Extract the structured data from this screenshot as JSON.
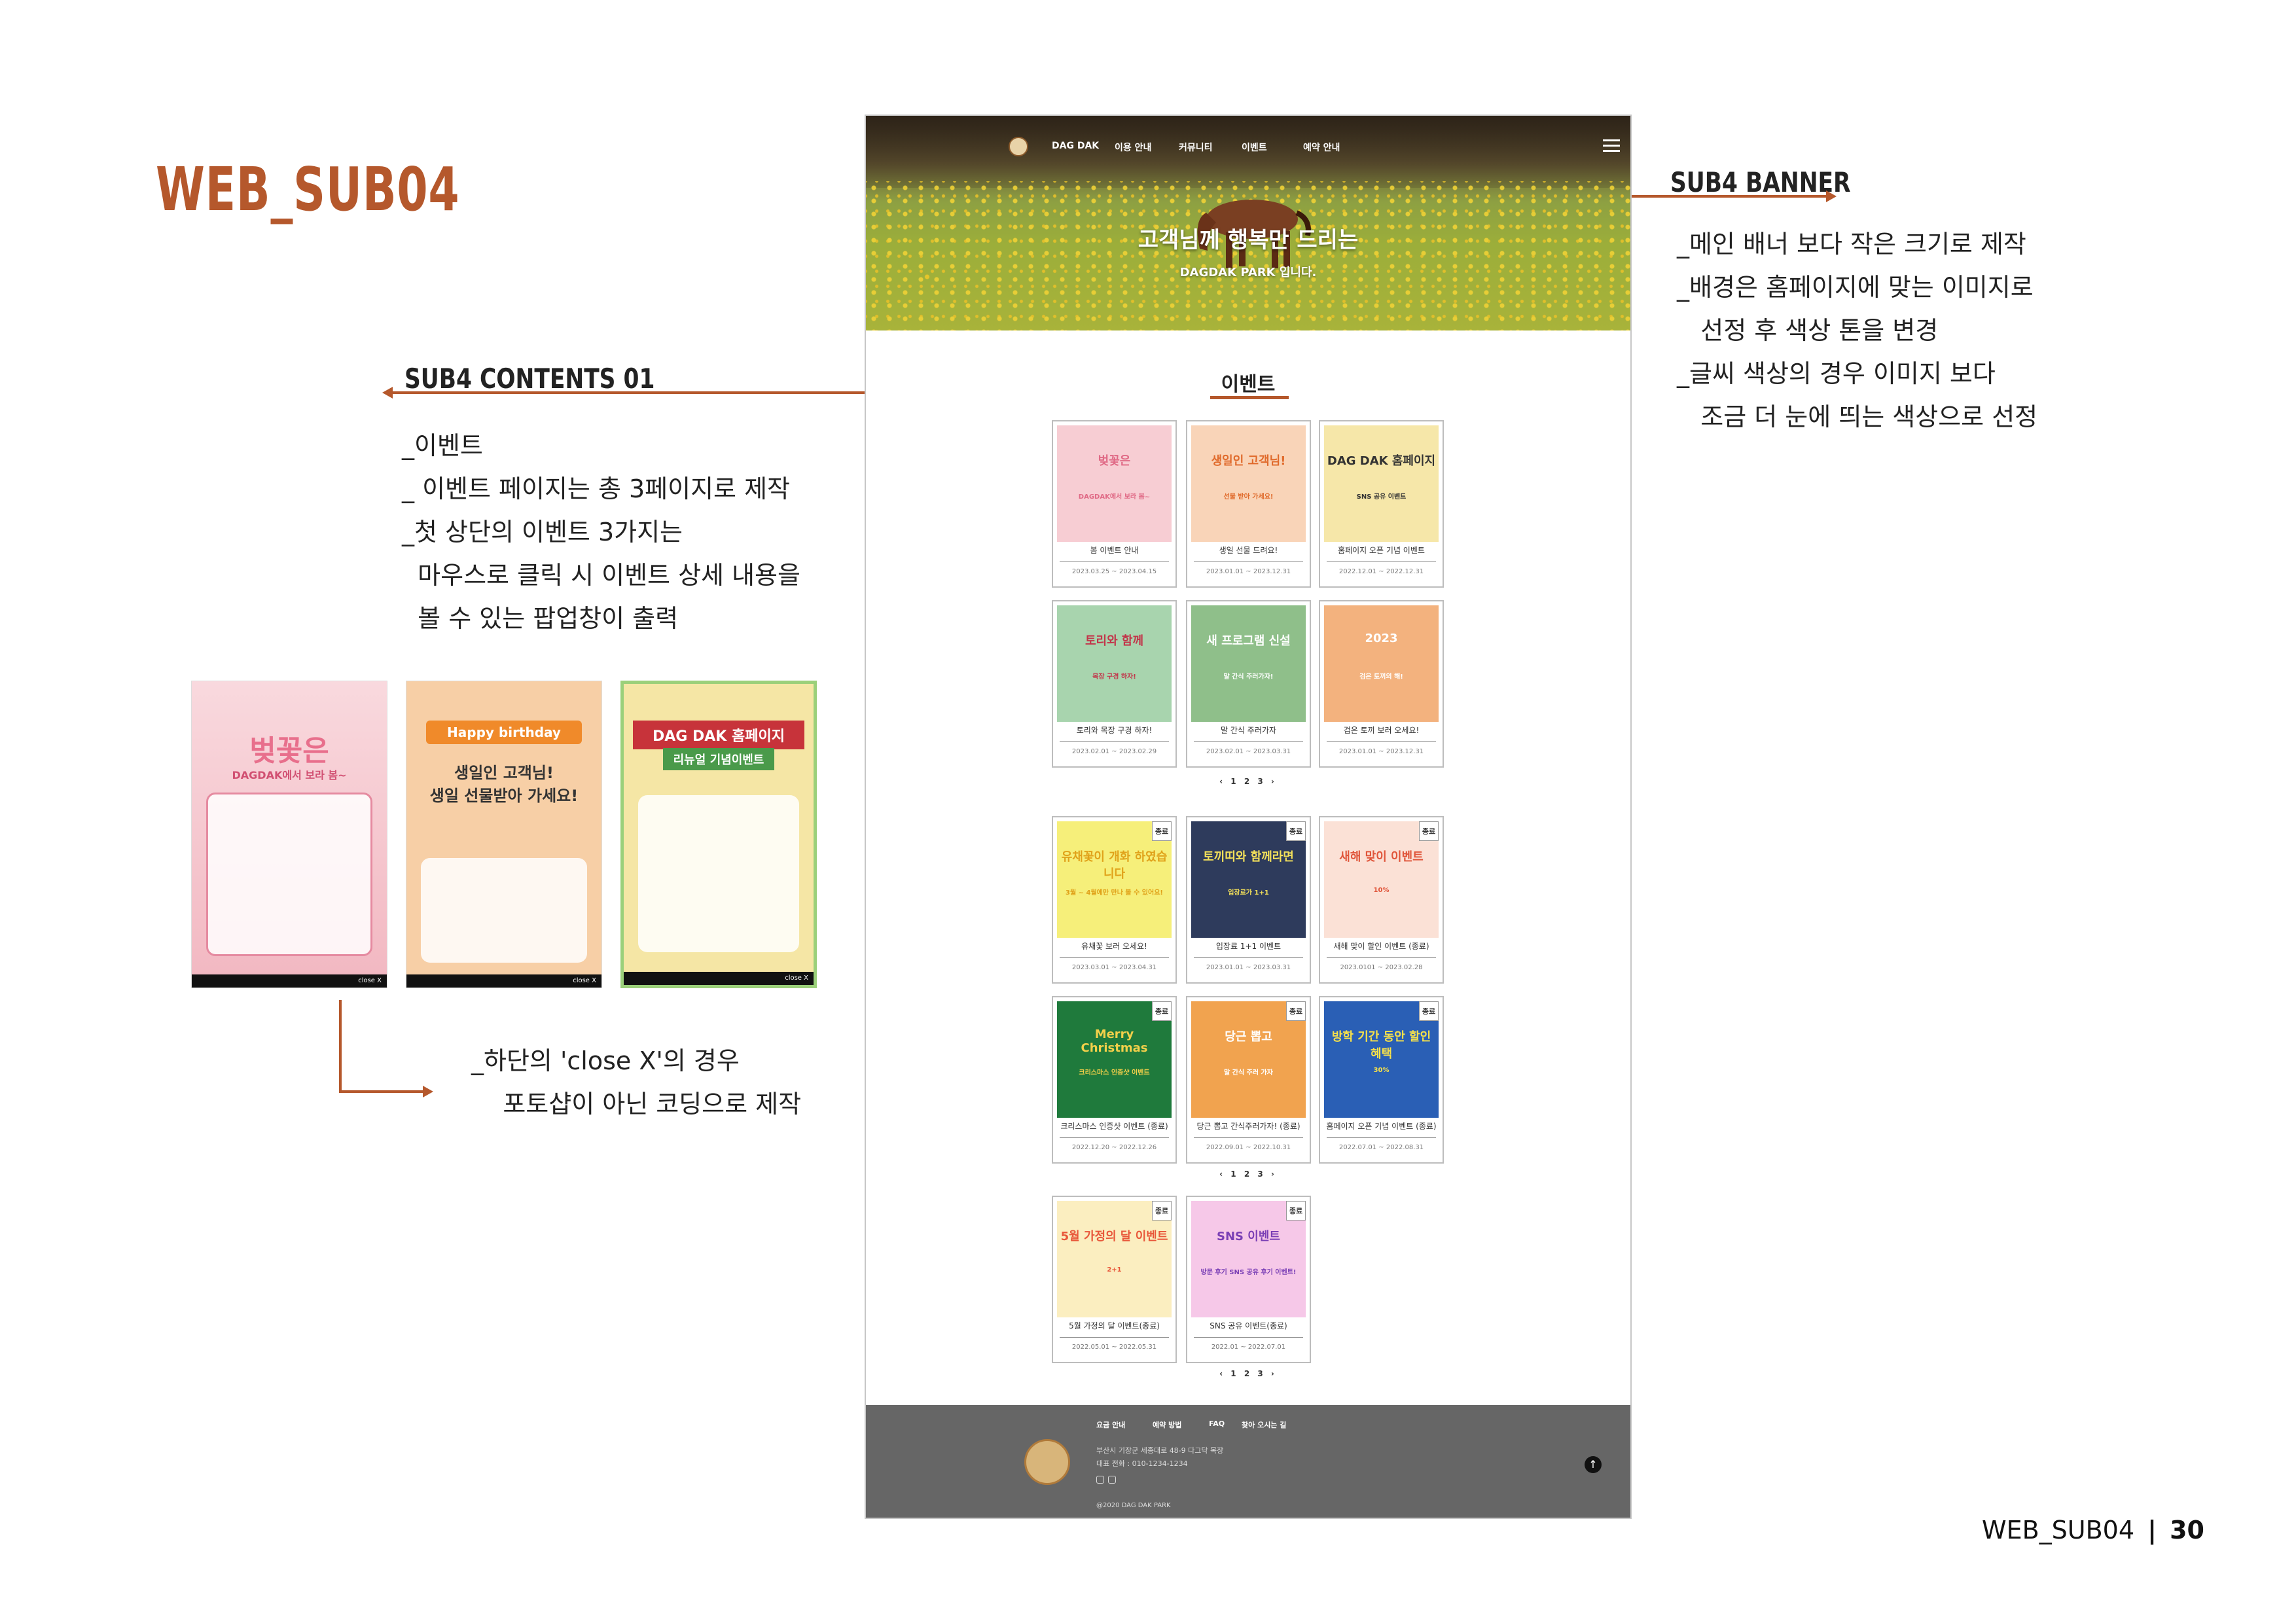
{
  "page_heading": "WEB_SUB04",
  "labels": {
    "banner": "SUB4 BANNER",
    "contents": "SUB4 CONTENTS  01"
  },
  "notes": {
    "banner": "_메인 배너 보다 작은 크기로 제작\n_배경은 홈페이지에 맞는 이미지로\n   선정 후 색상 톤을 변경\n_글씨 색상의 경우 이미지 보다\n   조금 더 눈에 띄는 색상으로 선정",
    "contents": "_이벤트\n_ 이벤트 페이지는 총 3페이지로 제작\n_첫 상단의 이벤트 3가지는\n  마우스로 클릭 시 이벤트 상세 내용을\n  볼 수 있는 팝업창이 출력",
    "close": "_하단의 'close X'의 경우\n    포토샵이 아닌 코딩으로 제작"
  },
  "popups": [
    {
      "title": "벚꽃은",
      "subtitle": "DAGDAK에서 보라 봄~",
      "close": "close X",
      "bg": "#f6c9d0"
    },
    {
      "title": "Happy birthday",
      "subtitle": "생일인 고객님!\n생일 선물받아 가세요!",
      "close": "close X",
      "bg": "#f7cfa6"
    },
    {
      "title": "DAG DAK 홈페이지",
      "subtitle": "리뉴얼 기념이벤트",
      "close": "close X",
      "bg": "#f5e6a5"
    }
  ],
  "site": {
    "nav": [
      "DAG DAK",
      "이용 안내",
      "커뮤니티",
      "이벤트",
      "예약 안내"
    ],
    "banner_title": "고객님께  행복만 드리는",
    "banner_sub": "DAGDAK PARK 입니다.",
    "section_title": "이벤트",
    "pager1": "‹ 1 2 3 ›",
    "pager2": "‹ 1 2 3 ›",
    "pager3": "‹ 1 2 3 ›",
    "tag_end": "종료",
    "cards": [
      {
        "t1": "벚꽃은",
        "t2": "DAGDAK에서 보라 봄~",
        "name": "봄 이벤트 안내",
        "date": "2023.03.25 ~ 2023.04.15",
        "bg": "#f7cdd3",
        "fg": "#e06a86"
      },
      {
        "t1": "생일인 고객님!",
        "t2": "선물 받아 가세요!",
        "name": "생일 선물 드려요!",
        "date": "2023.01.01 ~ 2023.12.31",
        "bg": "#f9d4b8",
        "fg": "#e06a2b"
      },
      {
        "t1": "DAG DAK 홈페이지",
        "t2": "SNS 공유 이벤트",
        "name": "홈페이지 오픈 기념 이벤트",
        "date": "2022.12.01 ~ 2022.12.31",
        "bg": "#f6e7a9",
        "fg": "#333"
      },
      {
        "t1": "토리와 함께",
        "t2": "목장 구경 하자!",
        "name": "토리와 목장 구경 하자!",
        "date": "2023.02.01 ~ 2023.02.29",
        "bg": "#a8d4ae",
        "fg": "#c2354a"
      },
      {
        "t1": "새 프로그램 신설",
        "t2": "말 간식 주러가자!",
        "name": "말 간식 주러가자",
        "date": "2023.02.01 ~ 2023.03.31",
        "bg": "#8fbf8a",
        "fg": "#fff"
      },
      {
        "t1": "2023",
        "t2": "검은 토끼의 해!",
        "name": "검은 토끼 보러 오세요!",
        "date": "2023.01.01 ~ 2023.12.31",
        "bg": "#f3b27e",
        "fg": "#fff"
      },
      {
        "t1": "유채꽃이 개화 하였습니다",
        "t2": "3월 ~ 4월에만 만나 볼 수 있어요!",
        "name": "유채꽃 보러 오세요!",
        "date": "2023.03.01 ~ 2023.04.31",
        "bg": "#f6ef7a",
        "fg": "#e0a21a"
      },
      {
        "t1": "토끼띠와 함께라면",
        "t2": "입장료가 1+1",
        "name": "입장료 1+1 이벤트",
        "date": "2023.01.01 ~ 2023.03.31",
        "bg": "#2e3b5c",
        "fg": "#f3e05a"
      },
      {
        "t1": "새해 맞이 이벤트",
        "t2": "10%",
        "name": "새해 맞이 할인 이벤트 (종료)",
        "date": "2023.0101 ~ 2023.02.28",
        "bg": "#fbe1d6",
        "fg": "#e0553a"
      },
      {
        "t1": "Merry Christmas",
        "t2": "크리스마스 인증샷 이벤트",
        "name": "크리스마스 인증샷 이벤트 (종료)",
        "date": "2022.12.20 ~ 2022.12.26",
        "bg": "#1f7a3c",
        "fg": "#f3d04a"
      },
      {
        "t1": "당근 뽑고",
        "t2": "말 간식 주러 가자",
        "name": "당근 뽑고 간식주러가자! (종료)",
        "date": "2022.09.01 ~ 2022.10.31",
        "bg": "#f1a34f",
        "fg": "#fff"
      },
      {
        "t1": "방학 기간 동안 할인혜택",
        "t2": "30%",
        "name": "홈페이지 오픈 기념 이벤트 (종료)",
        "date": "2022.07.01 ~ 2022.08.31",
        "bg": "#2a5fb5",
        "fg": "#f7e14a"
      },
      {
        "t1": "5월 가정의 달 이벤트",
        "t2": "2+1",
        "name": "5월 가정의 달 이벤트(종료)",
        "date": "2022.05.01 ~ 2022.05.31",
        "bg": "#fbeec0",
        "fg": "#e8573a"
      },
      {
        "t1": "SNS 이벤트",
        "t2": "방문 후기 SNS 공유 후기 이벤트!",
        "name": "SNS 공유 이벤트(종료)",
        "date": "2022.01 ~ 2022.07.01",
        "bg": "#f6c8e8",
        "fg": "#7a3fb5"
      }
    ],
    "footer": {
      "links": [
        "요금 안내",
        "예약 방법",
        "FAQ",
        "찾아 오시는 길"
      ],
      "address": "부산시 기장군 세종대로 48-9 다그닥 목장\n대표 전화 : 010-1234-1234",
      "copyright": "@2020 DAG DAK PARK"
    }
  },
  "page_number": {
    "label": "WEB_SUB04",
    "number": "30"
  }
}
